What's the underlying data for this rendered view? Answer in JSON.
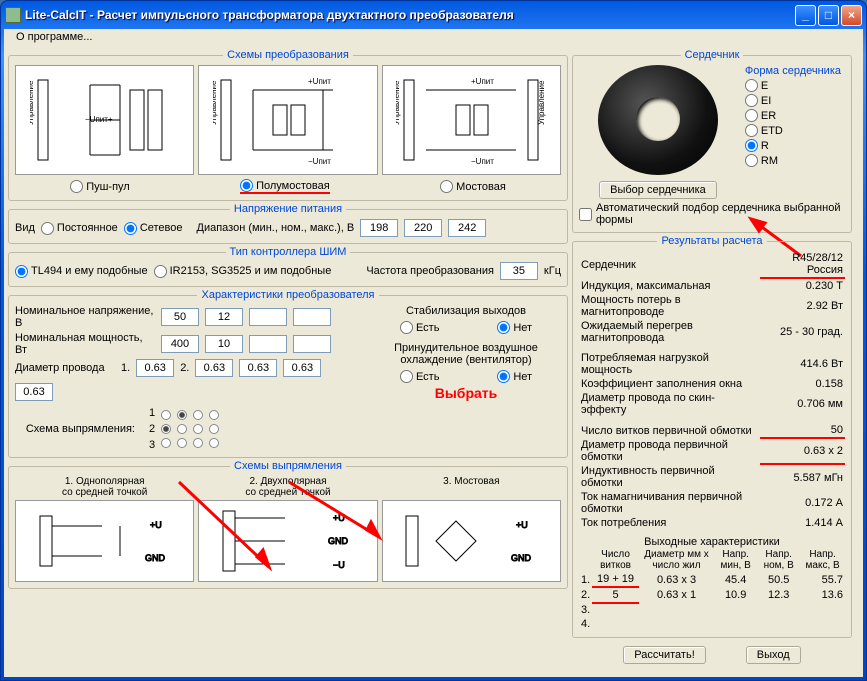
{
  "title": "Lite-CalcIT - Расчет импульсного трансформатора двухтактного преобразователя",
  "menu": {
    "about": "О программе..."
  },
  "topology": {
    "legend": "Схемы преобразования",
    "opt1": "Пуш-пул",
    "opt2": "Полумостовая",
    "opt3": "Мостовая",
    "selected": 2
  },
  "supply": {
    "legend": "Напряжение питания",
    "kind_label": "Вид",
    "kind_dc": "Постоянное",
    "kind_ac": "Сетевое",
    "range_label": "Диапазон (мин., ном., макс.), В",
    "vmin": "198",
    "vnom": "220",
    "vmax": "242"
  },
  "pwm": {
    "legend": "Тип контроллера ШИМ",
    "opt1": "TL494 и ему подобные",
    "opt2": "IR2153, SG3525 и им подобные",
    "freq_label": "Частота преобразования",
    "freq_val": "35",
    "freq_unit": "кГц"
  },
  "conv": {
    "legend": "Характеристики преобразователя",
    "vnom_label": "Номинальное напряжение, В",
    "pnom_label": "Номинальная мощность, Вт",
    "dwire_label": "Диаметр провода",
    "v1": "50",
    "v2": "12",
    "v3": "",
    "v4": "",
    "p1": "400",
    "p2": "10",
    "p3": "",
    "p4": "",
    "d1": "0.63",
    "d2": "0.63",
    "d3": "0.63",
    "d4": "0.63",
    "d5": "0.63",
    "stab_label": "Стабилизация выходов",
    "yes": "Есть",
    "no": "Нет",
    "fan_label": "Принудительное воздушное охлаждение (вентилятор)",
    "rect_label": "Схема выпрямления:",
    "choose_text": "Выбрать"
  },
  "rectifiers": {
    "legend": "Схемы выпрямления",
    "r1_t1": "1. Однополярная",
    "r1_t2": "со средней точкой",
    "r2_t1": "2. Двухполярная",
    "r2_t2": "со средней точкой",
    "r3_t1": "3. Мостовая",
    "r3_t2": ""
  },
  "core": {
    "legend": "Сердечник",
    "shape_legend": "Форма сердечника",
    "shapes": [
      "E",
      "EI",
      "ER",
      "ETD",
      "R",
      "RM"
    ],
    "selected_shape": "R",
    "choose_btn": "Выбор сердечника",
    "auto_label": "Автоматический подбор сердечника выбранной формы"
  },
  "results": {
    "legend": "Результаты расчета",
    "rows": [
      [
        "Сердечник",
        "R45/28/12 Россия"
      ],
      [
        "Индукция, максимальная",
        "0.230 Т"
      ],
      [
        "Мощность потерь в магнитопроводе",
        "2.92 Вт"
      ],
      [
        "Ожидаемый перегрев магнитопровода",
        "25 - 30 град."
      ],
      [
        "",
        ""
      ],
      [
        "Потребляемая нагрузкой мощность",
        "414.6 Вт"
      ],
      [
        "Коэффициент заполнения окна",
        "0.158"
      ],
      [
        "Диаметр провода по скин-эффекту",
        "0.706 мм"
      ],
      [
        "",
        ""
      ],
      [
        "Число витков первичной обмотки",
        "50"
      ],
      [
        "Диаметр провода первичной обмотки",
        "0.63 x 2"
      ],
      [
        "Индуктивность первичной обмотки",
        "5.587 мГн"
      ],
      [
        "Ток намагничивания первичной обмотки",
        "0.172 А"
      ],
      [
        "Ток потребления",
        "1.414 А"
      ]
    ],
    "outchar_legend": "Выходные характеристики",
    "outchar_headers": [
      "Число витков",
      "Диаметр мм х число жил",
      "Напр. мин, В",
      "Напр. ном, В",
      "Напр. макс, В"
    ],
    "outchar_rows": [
      [
        "1.",
        "19 + 19",
        "0.63 x 3",
        "45.4",
        "50.5",
        "55.7"
      ],
      [
        "2.",
        "5",
        "0.63 x 1",
        "10.9",
        "12.3",
        "13.6"
      ],
      [
        "3.",
        "",
        "",
        "",
        "",
        ""
      ],
      [
        "4.",
        "",
        "",
        "",
        "",
        ""
      ]
    ]
  },
  "buttons": {
    "calc": "Рассчитать!",
    "exit": "Выход"
  }
}
